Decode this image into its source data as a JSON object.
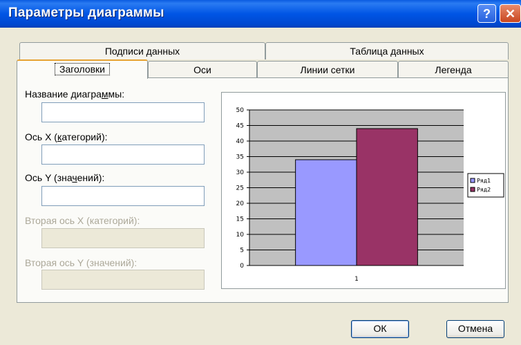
{
  "window": {
    "title": "Параметры диаграммы"
  },
  "icons": {
    "help": "?",
    "close": "✕"
  },
  "tabs": {
    "back": [
      {
        "label": "Подписи данных"
      },
      {
        "label": "Таблица данных"
      }
    ],
    "front": [
      {
        "label": "Заголовки",
        "active": true
      },
      {
        "label": "Оси"
      },
      {
        "label": "Линии сетки"
      },
      {
        "label": "Легенда"
      }
    ]
  },
  "form": {
    "chart_title": {
      "label_pre": "Название диагра",
      "label_key": "м",
      "label_post": "мы:",
      "value": ""
    },
    "x_axis": {
      "label_pre": "Ось X (",
      "label_key": "к",
      "label_post": "атегорий):",
      "value": ""
    },
    "y_axis": {
      "label_pre": "Ось Y (зна",
      "label_key": "ч",
      "label_post": "ений):",
      "value": ""
    },
    "x2_axis": {
      "label": "Вторая ось X (категорий):",
      "value": ""
    },
    "y2_axis": {
      "label": "Вторая ось Y (значений):",
      "value": ""
    }
  },
  "chart_data": {
    "type": "bar",
    "categories": [
      "1"
    ],
    "series": [
      {
        "name": "Ряд1",
        "values": [
          34
        ],
        "color": "#9999ff"
      },
      {
        "name": "Ряд2",
        "values": [
          44
        ],
        "color": "#993366"
      }
    ],
    "ylim": [
      0,
      50
    ],
    "yticks": [
      0,
      5,
      10,
      15,
      20,
      25,
      30,
      35,
      40,
      45,
      50
    ],
    "plot_bg": "#c0c0c0",
    "grid": true,
    "legend": "right"
  },
  "buttons": {
    "ok": "ОК",
    "cancel": "Отмена"
  }
}
